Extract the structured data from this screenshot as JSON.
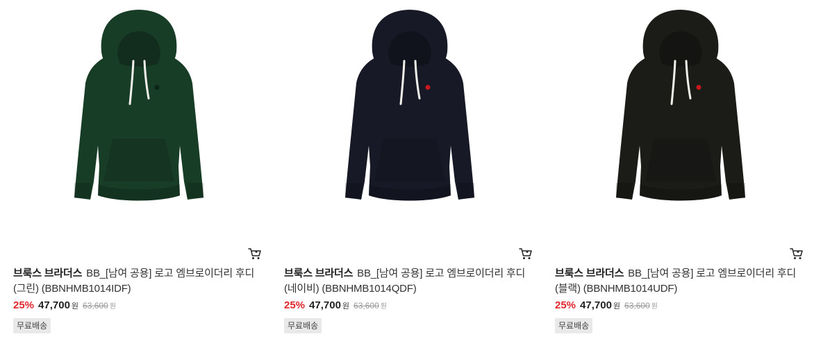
{
  "products": [
    {
      "brand": "브룩스 브라더스",
      "name": "BB_[남여 공용] 로고 엠브로이더리 후디 (그린) (BBNHMB1014IDF)",
      "discount": "25%",
      "sale_price": "47,700",
      "currency": "원",
      "original_price": "63,600",
      "original_currency": "원",
      "badge": "무료배송",
      "image": "hoodie-green",
      "color": "#183d27",
      "logo_color": "#0c2416"
    },
    {
      "brand": "브룩스 브라더스",
      "name": "BB_[남여 공용] 로고 엠브로이더리 후디 (네이비) (BBNHMB1014QDF)",
      "discount": "25%",
      "sale_price": "47,700",
      "currency": "원",
      "original_price": "63,600",
      "original_currency": "원",
      "badge": "무료배송",
      "image": "hoodie-navy",
      "color": "#171a26",
      "logo_color": "#c8161d"
    },
    {
      "brand": "브룩스 브라더스",
      "name": "BB_[남여 공용] 로고 엠브로이더리 후디 (블랙) (BBNHMB1014UDF)",
      "discount": "25%",
      "sale_price": "47,700",
      "currency": "원",
      "original_price": "63,600",
      "original_currency": "원",
      "badge": "무료배송",
      "image": "hoodie-black",
      "color": "#1b1c18",
      "logo_color": "#c8161d"
    }
  ],
  "icons": {
    "cart": "cart-icon"
  },
  "colors": {
    "discount": "#e0262d",
    "badge_bg": "#e9e9e9"
  }
}
